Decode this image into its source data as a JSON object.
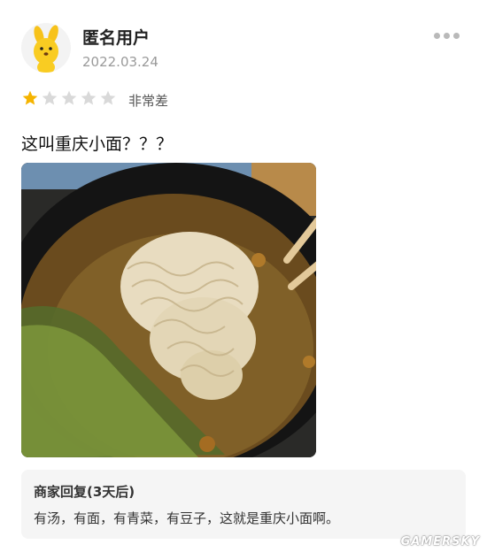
{
  "user": {
    "name": "匿名用户",
    "date": "2022.03.24",
    "avatar_icon": "yellow-dog-icon"
  },
  "rating": {
    "stars": 1,
    "max": 5,
    "label": "非常差",
    "filled_color": "#F5B400",
    "empty_color": "#D9D9D9"
  },
  "review": {
    "text": "这叫重庆小面？？？"
  },
  "reply": {
    "title": "商家回复(3天后)",
    "text": "有汤，有面，有青菜，有豆子，这就是重庆小面啊。"
  },
  "watermark": "GAMERSKY"
}
